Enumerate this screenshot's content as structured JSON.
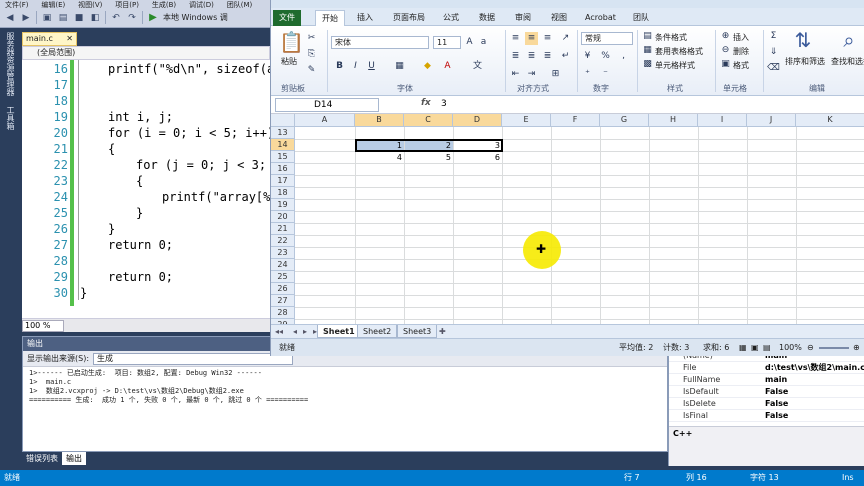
{
  "vs": {
    "menu": [
      "文件(F)",
      "编辑(E)",
      "视图(V)",
      "项目(P)",
      "生成(B)",
      "调试(D)",
      "团队(M)"
    ],
    "toolbar": {
      "run_label": "本地 Windows 调"
    },
    "left_tabs": [
      "服务器资源管理器",
      "工具箱"
    ],
    "doc_tab": "main.c",
    "scope": "(全局范围)",
    "zoom": "100 %",
    "editor": {
      "line_numbers": [
        "16",
        "17",
        "18",
        "19",
        "20",
        "21",
        "22",
        "23",
        "24",
        "25",
        "26",
        "27",
        "28",
        "29",
        "30"
      ],
      "lines": {
        "l16": "printf(\"%d\\n\", sizeof(ar",
        "l19": "int i, j;",
        "l20": "for (i = 0; i < 5; i++)",
        "l21": "{",
        "l22": "for (j = 0; j < 3; j",
        "l23": "{",
        "l24": "printf(\"array[%c",
        "l25": "}",
        "l26": "}",
        "l27": "return 0;",
        "l29": "return 0;",
        "l30": "}"
      }
    },
    "output": {
      "title": "输出",
      "source_label": "显示输出来源(S):",
      "source_value": "生成",
      "text": "1>------ 已启动生成:  项目: 数组2, 配置: Debug Win32 ------\n1>  main.c\n1>  数组2.vcxproj -> D:\\test\\vs\\数组2\\Debug\\数组2.exe\n========== 生成:  成功 1 个, 失败 0 个, 最新 0 个, 跳过 0 个 =========="
    },
    "bottom_tabs": [
      "错误列表",
      "输出"
    ],
    "properties": [
      {
        "name": "(Name)",
        "value": "main"
      },
      {
        "name": "File",
        "value": "d:\\test\\vs\\数组2\\main.c"
      },
      {
        "name": "FullName",
        "value": "main"
      },
      {
        "name": "IsDefault",
        "value": "False"
      },
      {
        "name": "IsDelete",
        "value": "False"
      },
      {
        "name": "IsFinal",
        "value": "False"
      }
    ],
    "prop_desc": "C++",
    "status": {
      "left": "就绪",
      "row": "行 7",
      "col": "列 16",
      "char": "字符 13",
      "ins": "Ins"
    }
  },
  "excel": {
    "tabs": [
      "文件",
      "开始",
      "插入",
      "页面布局",
      "公式",
      "数据",
      "审阅",
      "视图",
      "Acrobat",
      "团队"
    ],
    "ribbon": {
      "paste": "粘贴",
      "clipboard": "剪贴板",
      "font_name": "宋体",
      "font_size": "11",
      "font_group": "字体",
      "align_group": "对齐方式",
      "number_format": "常规",
      "number_group": "数字",
      "cond_format": "条件格式",
      "table_format": "套用表格格式",
      "cell_style": "单元格样式",
      "style_group": "样式",
      "insert": "插入",
      "delete": "删除",
      "format": "格式",
      "cells_group": "单元格",
      "sort_filter": "排序和筛选",
      "find_select": "查找和选择",
      "edit_group": "编辑"
    },
    "name_box": "D14",
    "formula_value": "3",
    "columns": [
      "A",
      "B",
      "C",
      "D",
      "E",
      "F",
      "G",
      "H",
      "I",
      "J",
      "K"
    ],
    "rows": [
      "13",
      "14",
      "15",
      "16",
      "17",
      "18",
      "19",
      "20",
      "21",
      "22",
      "23",
      "24",
      "25",
      "26",
      "27",
      "28",
      "29",
      "30"
    ],
    "cells": {
      "b14": "1",
      "c14": "2",
      "d14": "3",
      "b15": "4",
      "c15": "5",
      "d15": "6"
    },
    "sheets": [
      "Sheet1",
      "Sheet2",
      "Sheet3"
    ],
    "status": {
      "ready": "就绪",
      "average": "平均值: 2",
      "count": "计数: 3",
      "sum": "求和: 6",
      "zoom": "100%"
    }
  }
}
